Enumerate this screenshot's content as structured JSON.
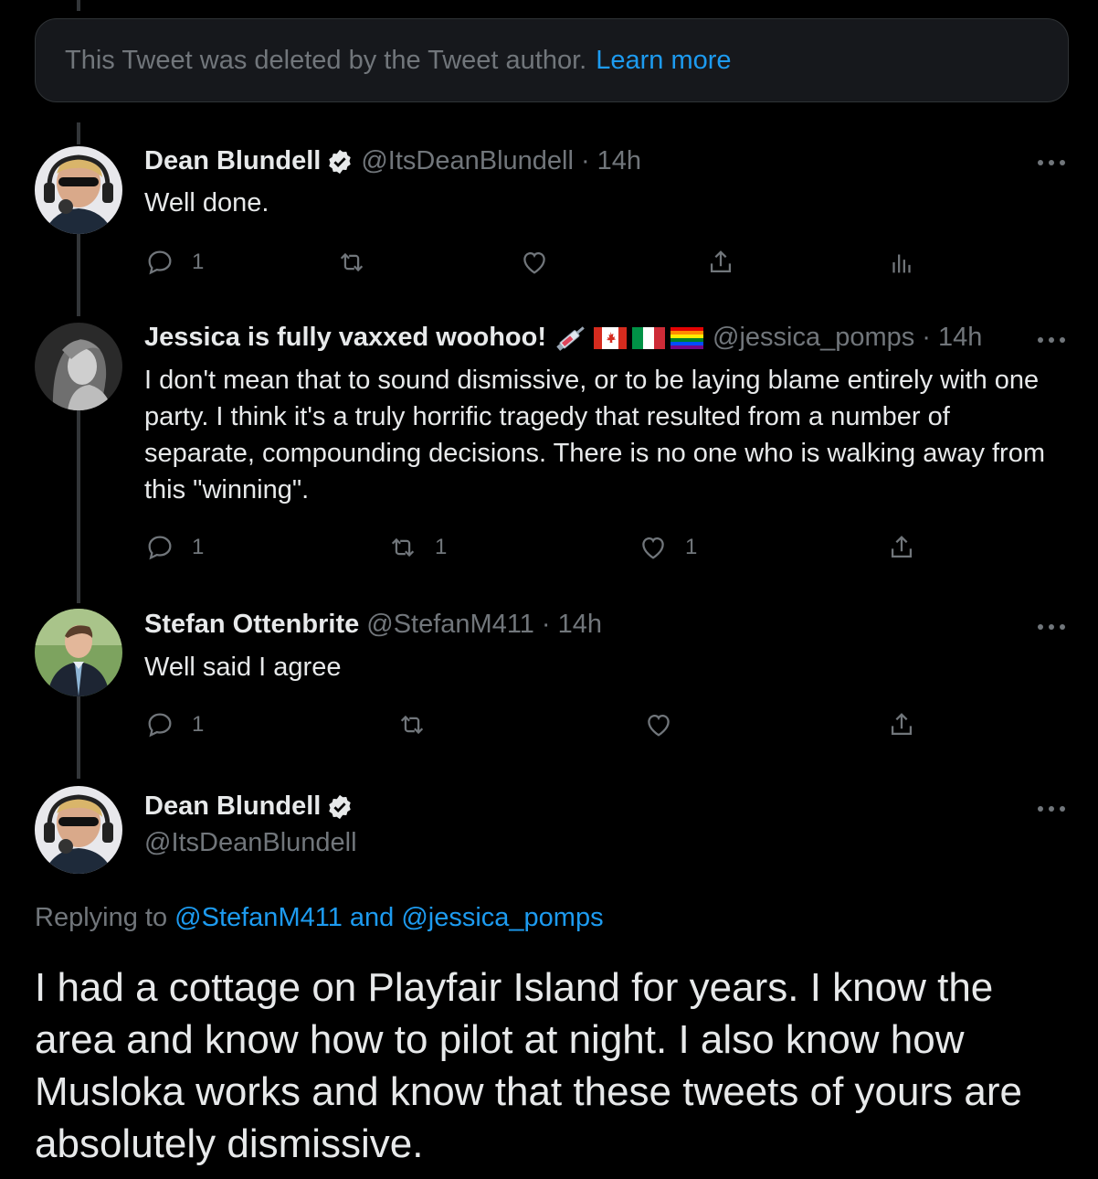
{
  "deleted_notice": {
    "text": "This Tweet was deleted by the Tweet author.",
    "link": "Learn more"
  },
  "replies": [
    {
      "name": "Dean Blundell",
      "verified": true,
      "handle": "@ItsDeanBlundell",
      "time": "· 14h",
      "text": "Well done.",
      "counts": {
        "reply": "1",
        "retweet": "",
        "like": ""
      }
    },
    {
      "name": "Jessica is fully vaxxed woohoo!",
      "handle": "@jessica_pomps",
      "time": "· 14h",
      "name_emoji": [
        "syringe-icon",
        "canada-flag-icon",
        "italy-flag-icon",
        "rainbow-flag-icon"
      ],
      "text": "I don't mean that to sound dismissive, or to be laying blame entirely with one party. I think it's a truly horrific tragedy that resulted from a number of separate, compounding decisions. There is no one who is walking away from this \"winning\".",
      "counts": {
        "reply": "1",
        "retweet": "1",
        "like": "1"
      }
    },
    {
      "name": "Stefan Ottenbrite",
      "handle": "@StefanM411",
      "time": "· 14h",
      "text": "Well said I agree",
      "counts": {
        "reply": "1",
        "retweet": "",
        "like": ""
      }
    }
  ],
  "main_tweet": {
    "name": "Dean Blundell",
    "verified": true,
    "handle": "@ItsDeanBlundell",
    "replying_prefix": "Replying to",
    "replying_user1": "@StefanM411",
    "replying_and": "and",
    "replying_user2": "@jessica_pomps",
    "text": "I had a cottage on Playfair Island for years.  I know the area and know how to pilot at night.  I also know how Musloka works and know that these tweets of yours are absolutely dismissive."
  },
  "colors": {
    "background": "#000000",
    "accent": "#1d9bf0",
    "muted": "#71767b",
    "text": "#e7e9ea"
  }
}
